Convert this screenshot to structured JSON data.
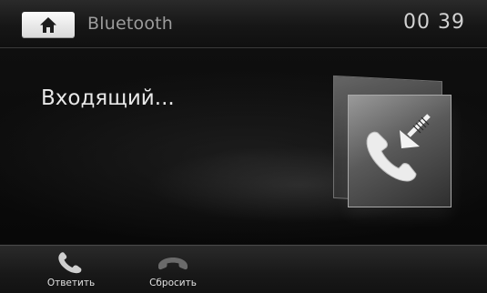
{
  "header": {
    "home_icon": "home-icon",
    "title": "Bluetooth",
    "time": "00 39"
  },
  "main": {
    "status_text": "Входящий...",
    "graphic_icon": "incoming-call-icon"
  },
  "actions": [
    {
      "label": "Ответить",
      "icon": "phone-answer-icon"
    },
    {
      "label": "Сбросить",
      "icon": "phone-hangup-icon"
    }
  ],
  "colors": {
    "background": "#0b0b0b",
    "home_button": "#e8e8e8",
    "title_text": "#9c9c9c"
  }
}
